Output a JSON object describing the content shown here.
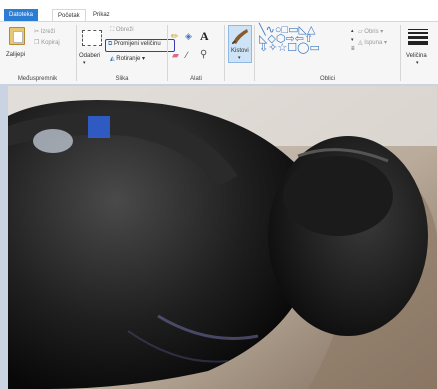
{
  "tabs": {
    "file": "Datoteka",
    "home": "Početak",
    "view": "Prikaz"
  },
  "clipboard": {
    "paste": "Zalijepi",
    "cut": "Izreži",
    "copy": "Kopiraj",
    "group_label": "Međuspremnik"
  },
  "image": {
    "select": "Odaberi",
    "crop": "Obreži",
    "resize": "Promijeni veličinu",
    "rotate": "Rotiranje",
    "group_label": "Slika"
  },
  "tools": {
    "text_icon": "A",
    "group_label": "Alati"
  },
  "brushes": {
    "label": "Kistovi"
  },
  "shapes": {
    "outline": "Obris",
    "fill": "Ispuna",
    "group_label": "Oblici"
  },
  "size": {
    "label": "Veličina"
  },
  "icons": [
    "paste-icon",
    "cut-icon",
    "copy-icon",
    "select-icon",
    "crop-icon",
    "resize-icon",
    "rotate-icon",
    "pencil-icon",
    "fill-icon",
    "text-icon",
    "eraser-icon",
    "color-picker-icon",
    "magnifier-icon",
    "brush-icon",
    "shapes-icon",
    "outline-icon",
    "fill-style-icon",
    "size-icon"
  ],
  "colors": {
    "file_tab": "#2b7cd3",
    "ribbon": "#f6f6f6",
    "highlight": "#3b3bb3",
    "workspace": "#c9d3e1"
  }
}
